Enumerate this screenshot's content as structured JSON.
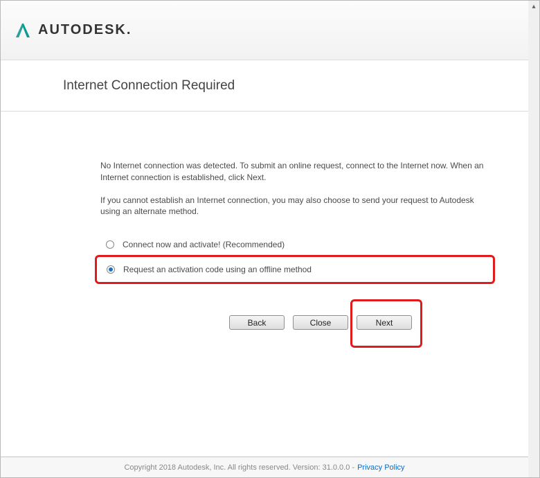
{
  "brand": {
    "name": "AUTODESK."
  },
  "page": {
    "title": "Internet Connection Required"
  },
  "message": {
    "line1": "No Internet connection was detected. To submit an online request, connect to the Internet now. When an Internet connection is established, click Next.",
    "line2": "If you cannot establish an Internet connection, you may also choose to send your request to Autodesk using an alternate method."
  },
  "options": {
    "connect": "Connect now and activate! (Recommended)",
    "offline": "Request an activation code using an offline method"
  },
  "buttons": {
    "back": "Back",
    "close": "Close",
    "next": "Next"
  },
  "footer": {
    "copyright": "Copyright 2018 Autodesk, Inc. All rights reserved. Version: 31.0.0.0 -",
    "privacy": "Privacy Policy"
  }
}
